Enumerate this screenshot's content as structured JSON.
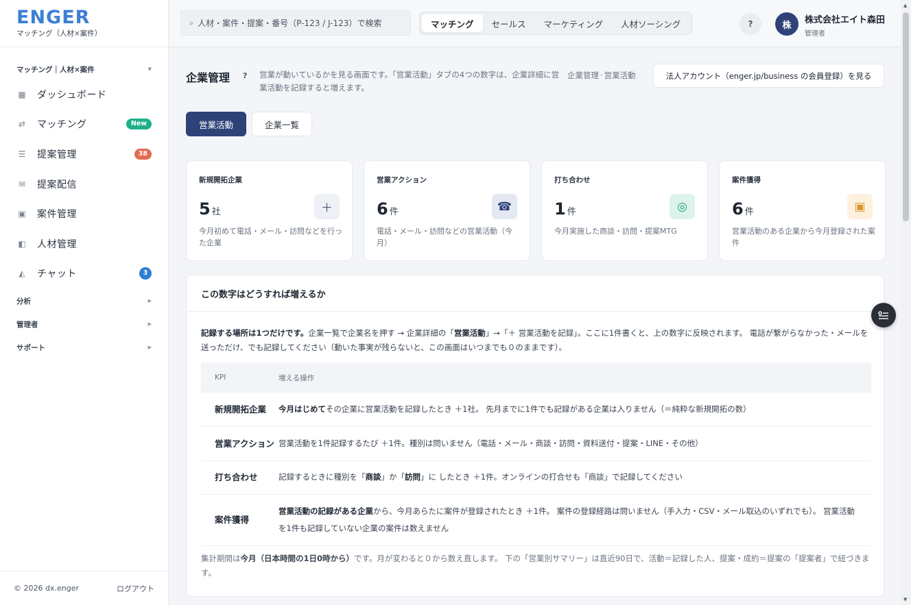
{
  "brand": {
    "logo": "ENGER",
    "subtitle": "マッチング（人材×案件）"
  },
  "sidebar": {
    "group_label": "マッチング｜人材×案件",
    "items": [
      {
        "label": "ダッシュボード",
        "icon": "grid-icon"
      },
      {
        "label": "マッチング",
        "icon": "swap-icon",
        "badge": "New"
      },
      {
        "label": "提案管理",
        "icon": "list-icon",
        "badge": "38"
      },
      {
        "label": "提案配信",
        "icon": "mail-icon"
      },
      {
        "label": "案件管理",
        "icon": "box-icon"
      },
      {
        "label": "人材管理",
        "icon": "person-card-icon"
      },
      {
        "label": "チャット",
        "icon": "chat-icon",
        "badge": "3"
      }
    ],
    "sections": [
      "分析",
      "管理者",
      "サポート"
    ],
    "footer": {
      "copyright": "© 2026 dx.enger",
      "logout": "ログアウト"
    }
  },
  "topbar": {
    "search_placeholder": "人材・案件・提案・番号（P-123 / J-123）で検索",
    "modes": [
      "マッチング",
      "セールス",
      "マーケティング",
      "人材ソーシング"
    ],
    "help": "?",
    "avatar": "株",
    "company": "株式会社エイト森田",
    "role": "管理者"
  },
  "page": {
    "title": "企業管理",
    "help": "?",
    "description": "営業が動いているかを見る画面です。「営業活動」タブの4つの数字は、企業詳細に営業活動を記録すると増えます。",
    "breadcrumb": [
      "企業管理",
      "営業活動"
    ],
    "corp_button": "法人アカウント（enger.jp/business の会員登録）を見る",
    "tabs": [
      "営業活動",
      "企業一覧"
    ]
  },
  "kpis": [
    {
      "label": "新規開拓企業",
      "value": "5",
      "unit": "社",
      "note": "今月初めて電話・メール・訪問などを行った企業",
      "icon": "plus-icon"
    },
    {
      "label": "営業アクション",
      "value": "6",
      "unit": "件",
      "note": "電話・メール・訪問などの営業活動（今月）",
      "icon": "phone-icon"
    },
    {
      "label": "打ち合わせ",
      "value": "1",
      "unit": "件",
      "note": "今月実施した商談・訪問・提案MTG",
      "icon": "target-icon"
    },
    {
      "label": "案件獲得",
      "value": "6",
      "unit": "件",
      "note": "営業活動のある企業から今月登録された案件",
      "icon": "box-icon"
    }
  ],
  "info": {
    "title": "この数字はどうすれば増えるか",
    "lead_bold": "記録する場所は1つだけです。",
    "lead_1": "企業一覧で企業名を押す → 企業詳細の「",
    "lead_bold2": "営業活動",
    "lead_2": "」→「＋ 営業活動を記録」。ここに1件書くと、上の数字に反映されます。 電話が繋がらなかった・メールを送っただけ、でも記録してください（動いた事実が残らないと、この画面はいつまでも０のままです）。",
    "table": {
      "headers": [
        "KPI",
        "増える操作"
      ],
      "rows": [
        {
          "kpi": "新規開拓企業",
          "b1": "今月はじめて",
          "t1": "その企業に営業活動を記録したとき ＋1社。 先月までに1件でも記録がある企業は入りません（＝純粋な新規開拓の数）"
        },
        {
          "kpi": "営業アクション",
          "t1": "営業活動を1件記録するたび ＋1件。種別は問いません（電話・メール・商談・訪問・資料送付・提案・LINE・その他）"
        },
        {
          "kpi": "打ち合わせ",
          "t1": "記録するときに種別を「",
          "b1": "商談",
          "t2": "」か「",
          "b2": "訪問",
          "t3": "」に したとき ＋1件。オンラインの打合せも「商談」で記録してください"
        },
        {
          "kpi": "案件獲得",
          "b1": "営業活動の記録がある企業",
          "t1": "から、今月あらたに案件が登録されたとき ＋1件。 案件の登録経路は問いません（手入力・CSV・メール取込のいずれでも）。 営業活動を1件も記録していない企業の案件は数えません"
        }
      ]
    },
    "foot_1": "集計期間は",
    "foot_bold": "今月（日本時間の1日0時から）",
    "foot_2": "です。月が変わると０から数え直します。 下の「営業別サマリー」は直近90日で、活動＝記録した人、提案・成約＝提案の「提案者」で紐づきます。"
  },
  "colors": {
    "primary": "#2f4278",
    "accent_blue": "#3b7fd6",
    "badge_new": "#1fb08a",
    "badge_red": "#e46a4e",
    "badge_blue": "#2d7fd3"
  }
}
